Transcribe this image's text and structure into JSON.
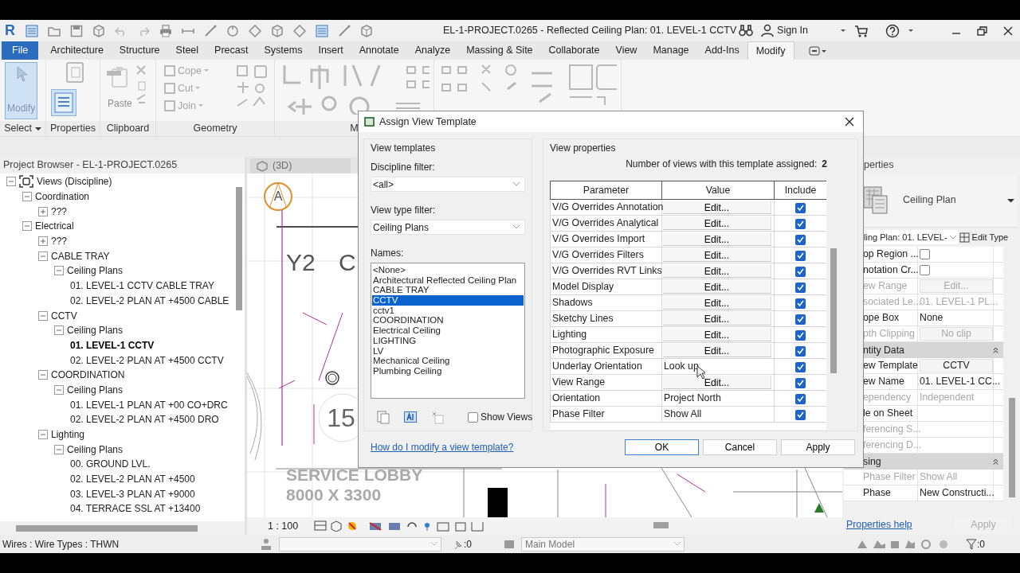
{
  "app_logo": "R",
  "title_bar": {
    "title": "EL-1-PROJECT.0265 - Reflected Ceiling Plan: 01. LEVEL-1 CCTV",
    "sign_in": "Sign In"
  },
  "ribbon_tabs": [
    {
      "label": "File",
      "kind": "file",
      "selected": false
    },
    {
      "label": "Architecture",
      "kind": "tab",
      "selected": false
    },
    {
      "label": "Structure",
      "kind": "tab",
      "selected": false
    },
    {
      "label": "Steel",
      "kind": "tab",
      "selected": false
    },
    {
      "label": "Precast",
      "kind": "tab",
      "selected": false
    },
    {
      "label": "Systems",
      "kind": "tab",
      "selected": false
    },
    {
      "label": "Insert",
      "kind": "tab",
      "selected": false
    },
    {
      "label": "Annotate",
      "kind": "tab",
      "selected": false
    },
    {
      "label": "Analyze",
      "kind": "tab",
      "selected": false
    },
    {
      "label": "Massing & Site",
      "kind": "tab",
      "selected": false
    },
    {
      "label": "Collaborate",
      "kind": "tab",
      "selected": false
    },
    {
      "label": "View",
      "kind": "tab",
      "selected": false
    },
    {
      "label": "Manage",
      "kind": "tab",
      "selected": false
    },
    {
      "label": "Add-Ins",
      "kind": "tab",
      "selected": false
    },
    {
      "label": "Modify",
      "kind": "tab",
      "selected": true
    }
  ],
  "ribbon_groups": [
    {
      "label": "Select",
      "dropdown": true,
      "tools": [
        {
          "label": "Modify",
          "kind": "large",
          "active": true,
          "disabled": false
        }
      ]
    },
    {
      "label": "Properties",
      "dropdown": false,
      "tools": [
        {
          "kind": "large",
          "active": true,
          "disabled": false
        }
      ]
    },
    {
      "label": "Clipboard",
      "dropdown": false,
      "tools": [
        {
          "label": "Paste",
          "kind": "large",
          "active": false,
          "disabled": true
        }
      ]
    },
    {
      "label": "Geometry",
      "dropdown": false,
      "tools": [
        {
          "label": "Cope",
          "kind": "small",
          "active": false,
          "disabled": true
        },
        {
          "label": "Cut",
          "kind": "small",
          "active": false,
          "disabled": true
        },
        {
          "label": "Join",
          "kind": "small",
          "active": false,
          "disabled": true
        }
      ]
    },
    {
      "label": "M",
      "dropdown": false
    }
  ],
  "browser": {
    "title": "Project Browser - EL-1-PROJECT.0265",
    "tree": [
      {
        "label": "Views (Discipline)",
        "expanded": true,
        "children": [
          {
            "label": "Coordination",
            "expanded": true,
            "children": [
              {
                "label": "???",
                "expanded": false
              }
            ]
          },
          {
            "label": "Electrical",
            "expanded": true,
            "children": [
              {
                "label": "???",
                "expanded": false
              },
              {
                "label": "CABLE TRAY",
                "expanded": true,
                "children": [
                  {
                    "label": "Ceiling Plans",
                    "expanded": true,
                    "children": [
                      {
                        "label": "01. LEVEL-1 CCTV CABLE TRAY",
                        "current": false
                      },
                      {
                        "label": "02. LEVEL-2 PLAN AT +4500 CABLE",
                        "current": false
                      }
                    ]
                  }
                ]
              },
              {
                "label": "CCTV",
                "expanded": true,
                "children": [
                  {
                    "label": "Ceiling Plans",
                    "expanded": true,
                    "children": [
                      {
                        "label": "01. LEVEL-1 CCTV",
                        "current": true
                      },
                      {
                        "label": "02. LEVEL-2 PLAN AT +4500 CCTV",
                        "current": false
                      }
                    ]
                  }
                ]
              },
              {
                "label": "COORDINATION",
                "expanded": true,
                "children": [
                  {
                    "label": "Ceiling Plans",
                    "expanded": true,
                    "children": [
                      {
                        "label": "01. LEVEL-1 PLAN AT +00 CO+DRC",
                        "current": false
                      },
                      {
                        "label": "02. LEVEL-2 PLAN AT +4500 DRO",
                        "current": false
                      }
                    ]
                  }
                ]
              },
              {
                "label": "Lighting",
                "expanded": true,
                "children": [
                  {
                    "label": "Ceiling Plans",
                    "expanded": true,
                    "children": [
                      {
                        "label": "00. GROUND LVL.",
                        "current": false
                      },
                      {
                        "label": "02. LEVEL-2 PLAN AT +4500",
                        "current": false
                      },
                      {
                        "label": "03. LEVEL-3 PLAN AT +9000",
                        "current": false
                      },
                      {
                        "label": "04. TERRACE SSL AT +13400",
                        "current": false
                      }
                    ]
                  }
                ]
              }
            ]
          }
        ]
      }
    ]
  },
  "canvas": {
    "tab": "(3D)",
    "labels": [
      {
        "text": "A",
        "kind": "grid"
      },
      {
        "text": "Y2",
        "kind": "grid"
      },
      {
        "text": "C",
        "kind": "grid"
      },
      {
        "text": "15",
        "kind": "tag"
      },
      {
        "text": "SERVICE LOBBY",
        "kind": "room"
      },
      {
        "text": "8000 X 3300",
        "kind": "room"
      }
    ],
    "scale": "1 : 100"
  },
  "properties_panel": {
    "title": "perties",
    "type_name": "Ceiling Plan",
    "instance": "ling Plan: 01. LEVEL-",
    "edit_type": "Edit Type",
    "rows": [
      {
        "kind": "checkbox",
        "label": "op Region ...",
        "checked": false,
        "disabled": false
      },
      {
        "kind": "checkbox",
        "label": "notation Cr...",
        "checked": false,
        "disabled": false
      },
      {
        "kind": "button",
        "label": "ew Range",
        "value": "Edit...",
        "disabled": true
      },
      {
        "kind": "text",
        "label": "sociated Le...",
        "value": "01. LEVEL-1 PL...",
        "disabled": true
      },
      {
        "kind": "text",
        "label": "ope Box",
        "value": "None",
        "disabled": false
      },
      {
        "kind": "button",
        "label": "pth Clipping",
        "value": "No clip",
        "disabled": true
      },
      {
        "kind": "section",
        "label": "ntity Data"
      },
      {
        "kind": "button",
        "label": "ew Template",
        "value": "CCTV",
        "disabled": false
      },
      {
        "kind": "text",
        "label": "ew Name",
        "value": "01. LEVEL-1 CC...",
        "disabled": false
      },
      {
        "kind": "text",
        "label": "ependency",
        "value": "Independent",
        "disabled": true
      },
      {
        "kind": "text",
        "label": "le on Sheet",
        "disabled": false
      },
      {
        "kind": "text",
        "label": "ferencing S...",
        "disabled": true
      },
      {
        "kind": "text",
        "label": "ferencing D...",
        "disabled": true
      },
      {
        "kind": "section",
        "label": "sing"
      },
      {
        "kind": "text",
        "label": "Phase Filter",
        "value": "Show All",
        "disabled": true
      },
      {
        "kind": "text",
        "label": "Phase",
        "value": "New Constructi...",
        "disabled": false
      }
    ],
    "help": "Properties help",
    "apply": {
      "label": "Apply",
      "disabled": true
    }
  },
  "dialog": {
    "title": "Assign View Template",
    "templates": {
      "legend": "View templates",
      "discipline_label": "Discipline filter:",
      "discipline_value": "<all>",
      "type_label": "View type filter:",
      "type_value": "Ceiling Plans",
      "names_label": "Names:",
      "names": [
        {
          "label": "<None>",
          "selected": false
        },
        {
          "label": "Architectural Reflected Ceiling Plan",
          "selected": false
        },
        {
          "label": "CABLE TRAY",
          "selected": false
        },
        {
          "label": "CCTV",
          "selected": true
        },
        {
          "label": "cctv1",
          "selected": false
        },
        {
          "label": "COORDINATION",
          "selected": false
        },
        {
          "label": "Electrical Ceiling",
          "selected": false
        },
        {
          "label": "LIGHTING",
          "selected": false
        },
        {
          "label": "LV",
          "selected": false
        },
        {
          "label": "Mechanical Ceiling",
          "selected": false
        },
        {
          "label": "Plumbing Ceiling",
          "selected": false
        }
      ],
      "show_views": {
        "label": "Show Views",
        "checked": false
      }
    },
    "properties": {
      "legend": "View properties",
      "count_label": "Number of views with this template assigned:",
      "count": "2",
      "columns": [
        "Parameter",
        "Value",
        "Include"
      ],
      "rows": [
        {
          "parameter": "V/G Overrides Annotation",
          "value": "Edit...",
          "kind": "button",
          "include": true
        },
        {
          "parameter": "V/G Overrides Analytical",
          "value": "Edit...",
          "kind": "button",
          "include": true
        },
        {
          "parameter": "V/G Overrides Import",
          "value": "Edit...",
          "kind": "button",
          "include": true
        },
        {
          "parameter": "V/G Overrides Filters",
          "value": "Edit...",
          "kind": "button",
          "include": true
        },
        {
          "parameter": "V/G Overrides RVT Links",
          "value": "Edit...",
          "kind": "button",
          "include": true
        },
        {
          "parameter": "Model Display",
          "value": "Edit...",
          "kind": "button",
          "include": true
        },
        {
          "parameter": "Shadows",
          "value": "Edit...",
          "kind": "button",
          "include": true
        },
        {
          "parameter": "Sketchy Lines",
          "value": "Edit...",
          "kind": "button",
          "include": true
        },
        {
          "parameter": "Lighting",
          "value": "Edit...",
          "kind": "button",
          "include": true
        },
        {
          "parameter": "Photographic Exposure",
          "value": "Edit...",
          "kind": "button",
          "include": true
        },
        {
          "parameter": "Underlay Orientation",
          "value": "Look up",
          "kind": "text",
          "include": true
        },
        {
          "parameter": "View Range",
          "value": "Edit...",
          "kind": "button",
          "include": true
        },
        {
          "parameter": "Orientation",
          "value": "Project North",
          "kind": "text",
          "include": true
        },
        {
          "parameter": "Phase Filter",
          "value": "Show All",
          "kind": "text",
          "include": true
        }
      ]
    },
    "help_link": "How do I modify a view template?",
    "buttons": [
      {
        "label": "OK",
        "default": true
      },
      {
        "label": "Cancel",
        "default": false
      },
      {
        "label": "Apply",
        "default": false
      }
    ]
  },
  "status_bar": {
    "message": "Wires : Wire Types : THWN",
    "selection_count": ":0",
    "workset": "Main Model",
    "filter_count": ":0"
  }
}
